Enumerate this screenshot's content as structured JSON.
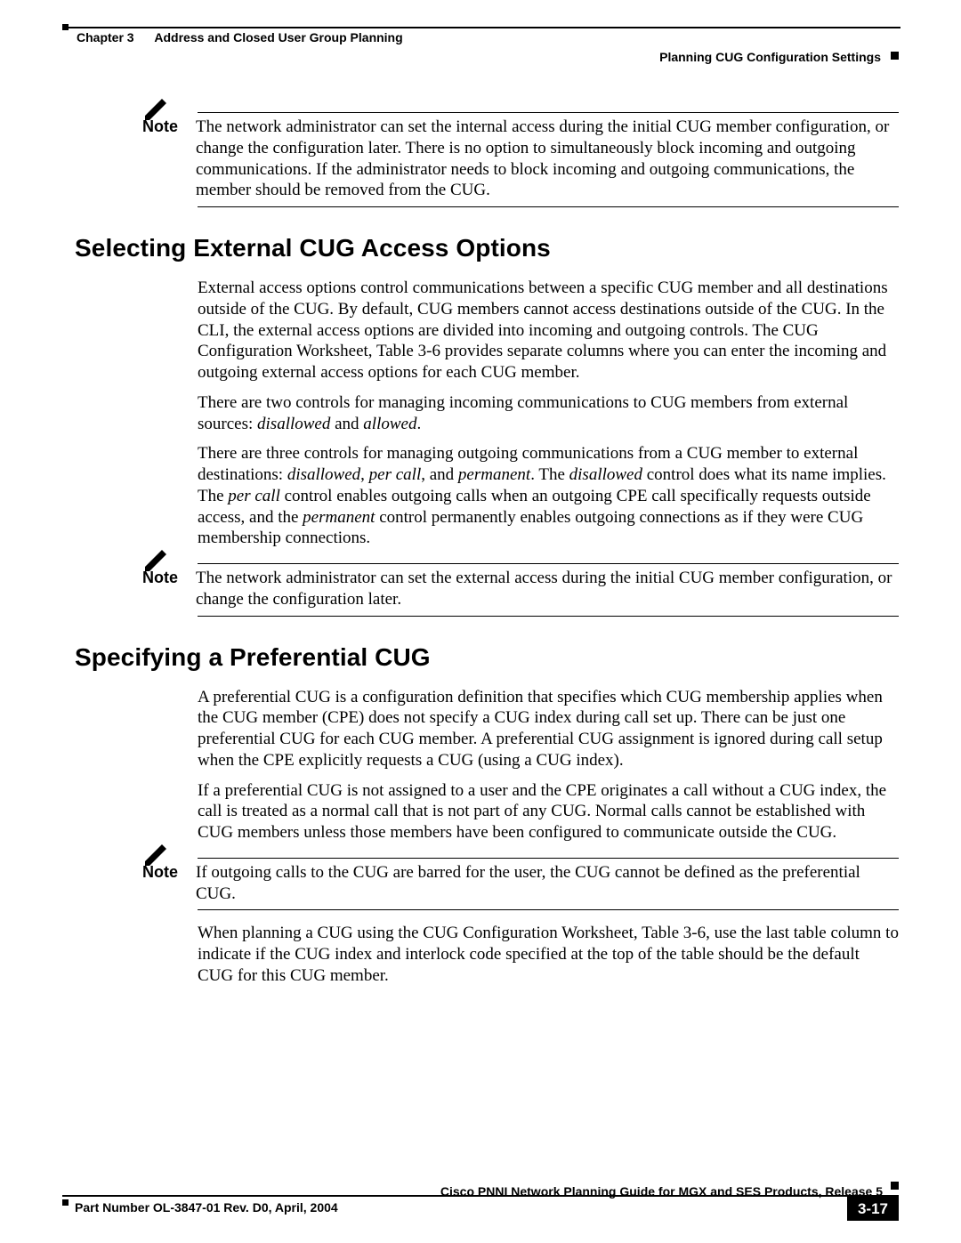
{
  "header": {
    "chapter": "Chapter 3      Address and Closed User Group Planning",
    "section": "Planning CUG Configuration Settings"
  },
  "notes": {
    "label": "Note",
    "n1": "The network administrator can set the internal access during the initial CUG member configuration, or change the configuration later. There is no option to simultaneously block incoming and outgoing communications. If the administrator needs to block incoming and outgoing communications, the member should be removed from the CUG.",
    "n2": "The network administrator can set the external access during the initial CUG member configuration, or change the configuration later.",
    "n3": "If outgoing calls to the CUG are barred for the user, the CUG cannot be defined as the preferential CUG."
  },
  "sections": {
    "s1": {
      "title": "Selecting External CUG Access Options",
      "p1": "External access options control communications between a specific CUG member and all destinations outside of the CUG. By default, CUG members cannot access destinations outside of the CUG. In the CLI, the external access options are divided into incoming and outgoing controls. The CUG Configuration Worksheet, Table 3-6 provides separate columns where you can enter the incoming and outgoing external access options for each CUG member.",
      "p2_a": "There are two controls for managing incoming communications to CUG members from external sources: ",
      "p2_i1": "disallowed",
      "p2_mid": " and ",
      "p2_i2": "allowed",
      "p2_end": ".",
      "p3_a": "There are three controls for managing outgoing communications from a CUG member to external destinations: ",
      "p3_i1": "disallowed",
      "p3_c1": ", ",
      "p3_i2": "per call",
      "p3_c2": ", and ",
      "p3_i3": "permanent",
      "p3_c3": ". The ",
      "p3_i4": "disallowed",
      "p3_c4": " control does what its name implies. The ",
      "p3_i5": "per call",
      "p3_c5": " control enables outgoing calls when an outgoing CPE call specifically requests outside access, and the ",
      "p3_i6": "permanent",
      "p3_c6": " control permanently enables outgoing connections as if they were CUG membership connections."
    },
    "s2": {
      "title": "Specifying a Preferential CUG",
      "p1": "A preferential CUG is a configuration definition that specifies which CUG membership applies when the CUG member (CPE) does not specify a CUG index during call set up. There can be just one preferential CUG for each CUG member. A preferential CUG assignment is ignored during call setup when the CPE explicitly requests a CUG (using a CUG index).",
      "p2": "If a preferential CUG is not assigned to a user and the CPE originates a call without a CUG index, the call is treated as a normal call that is not part of any CUG. Normal calls cannot be established with CUG members unless those members have been configured to communicate outside the CUG.",
      "p3": "When planning a CUG using the CUG Configuration Worksheet, Table 3-6, use the last table column to indicate if the CUG index and interlock code specified at the top of the table should be the default CUG for this CUG member."
    }
  },
  "footer": {
    "doc_title": "Cisco PNNI Network Planning Guide  for MGX and SES Products, Release 5",
    "part": "Part Number OL-3847-01 Rev. D0, April, 2004",
    "page_num": "3-17"
  }
}
